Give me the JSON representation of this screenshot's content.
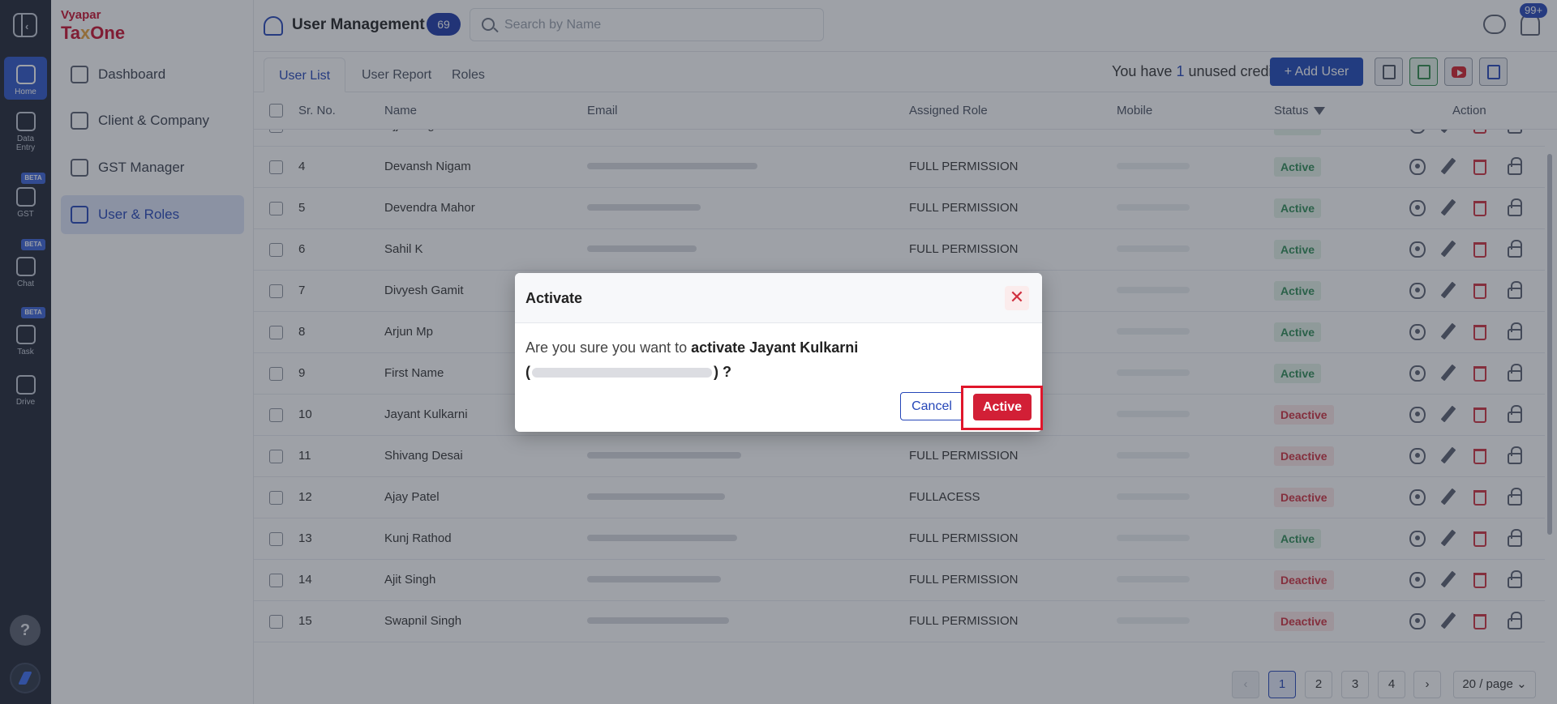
{
  "rail": {
    "items": [
      {
        "label": "Home",
        "icon": "home-icon"
      },
      {
        "label": "Data Entry",
        "icon": "data-entry-icon"
      },
      {
        "label": "GST",
        "icon": "gst-icon",
        "badge": "BETA"
      },
      {
        "label": "Chat",
        "icon": "chat-icon",
        "badge": "BETA"
      },
      {
        "label": "Task",
        "icon": "task-icon",
        "badge": "BETA"
      },
      {
        "label": "Drive",
        "icon": "drive-icon"
      }
    ],
    "help": "?"
  },
  "brand": {
    "line1": "Vyapar",
    "line2a": "Ta",
    "line2x": "x",
    "line2b": "One"
  },
  "sidebar": {
    "items": [
      {
        "label": "Dashboard"
      },
      {
        "label": "Client & Company"
      },
      {
        "label": "GST Manager"
      },
      {
        "label": "User & Roles"
      }
    ]
  },
  "header": {
    "title": "User Management",
    "count": "69",
    "search_placeholder": "Search by Name",
    "notif_badge": "99+"
  },
  "tabs": [
    {
      "label": "User List"
    },
    {
      "label": "User Report"
    },
    {
      "label": "Roles"
    }
  ],
  "toolbar": {
    "credits_prefix": "You have",
    "credits_num": "1",
    "credits_suffix": "unused credits",
    "add_user": "+ Add User"
  },
  "table": {
    "columns": {
      "srno": "Sr. No.",
      "name": "Name",
      "email": "Email",
      "role": "Assigned Role",
      "mobile": "Mobile",
      "status": "Status",
      "action": "Action"
    },
    "rows": [
      {
        "sr": "3",
        "name": "Ujjwal Agrawal",
        "role": "FULL PERMISSION",
        "status": "Active"
      },
      {
        "sr": "4",
        "name": "Devansh Nigam",
        "role": "FULL PERMISSION",
        "status": "Active"
      },
      {
        "sr": "5",
        "name": "Devendra Mahor",
        "role": "FULL PERMISSION",
        "status": "Active"
      },
      {
        "sr": "6",
        "name": "Sahil K",
        "role": "FULL PERMISSION",
        "status": "Active"
      },
      {
        "sr": "7",
        "name": "Divyesh Gamit",
        "role": "",
        "status": "Active"
      },
      {
        "sr": "8",
        "name": "Arjun Mp",
        "role": "",
        "status": "Active"
      },
      {
        "sr": "9",
        "name": "First Name",
        "role": "",
        "status": "Active"
      },
      {
        "sr": "10",
        "name": "Jayant Kulkarni",
        "role": "",
        "status": "Deactive"
      },
      {
        "sr": "11",
        "name": "Shivang Desai",
        "role": "FULL PERMISSION",
        "status": "Deactive"
      },
      {
        "sr": "12",
        "name": "Ajay Patel",
        "role": "FULLACESS",
        "status": "Deactive"
      },
      {
        "sr": "13",
        "name": "Kunj Rathod",
        "role": "FULL PERMISSION",
        "status": "Active"
      },
      {
        "sr": "14",
        "name": "Ajit Singh",
        "role": "FULL PERMISSION",
        "status": "Deactive"
      },
      {
        "sr": "15",
        "name": "Swapnil Singh",
        "role": "FULL PERMISSION",
        "status": "Deactive"
      }
    ]
  },
  "pagination": {
    "pages": [
      "1",
      "2",
      "3",
      "4"
    ],
    "current": "1",
    "page_size": "20 / page"
  },
  "modal": {
    "title": "Activate",
    "close": "✕",
    "text_pre": "Are you sure you want to",
    "text_bold": "activate Jayant Kulkarni",
    "paren_open": "(",
    "paren_close": ") ?",
    "cancel": "Cancel",
    "confirm": "Active"
  },
  "colors": {
    "primary": "#1e47b8",
    "danger": "#d21f36",
    "rail": "#1f2533"
  }
}
